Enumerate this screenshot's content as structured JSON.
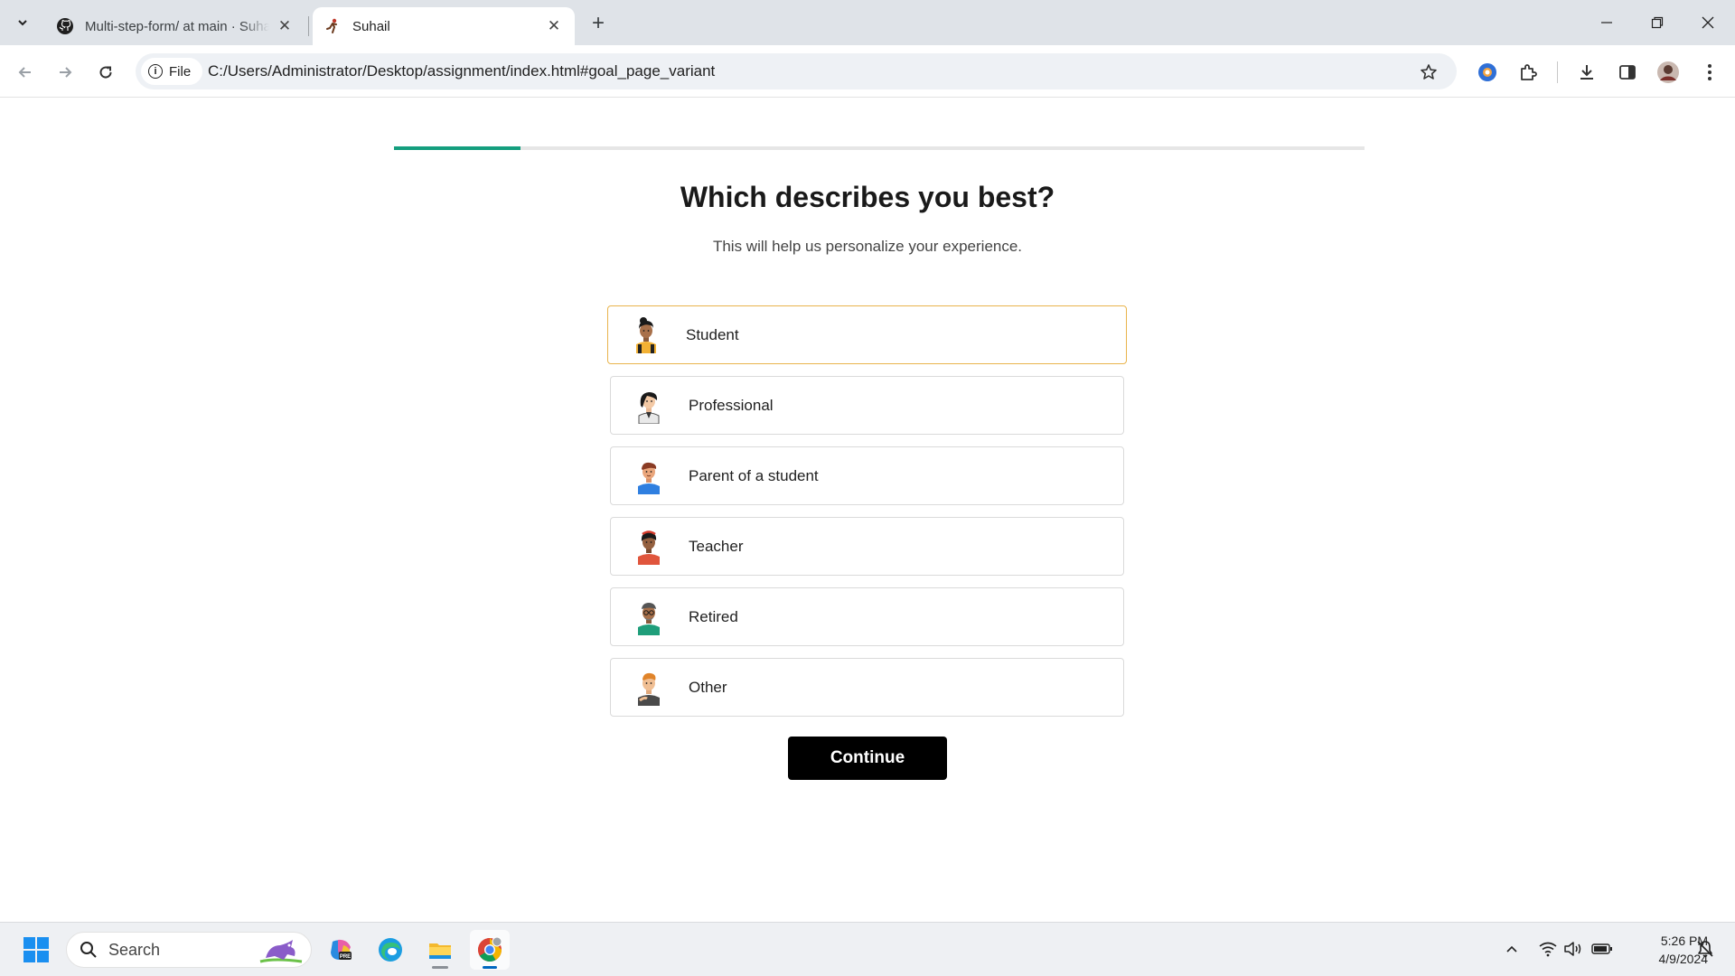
{
  "browser": {
    "tabs": [
      {
        "title": "Multi-step-form/ at main · Suhail",
        "icon": "github-icon",
        "active": false
      },
      {
        "title": "Suhail",
        "icon": "runner-favicon",
        "active": true
      }
    ],
    "address": {
      "chip_label": "File",
      "url": "C:/Users/Administrator/Desktop/assignment/index.html#goal_page_variant"
    }
  },
  "page": {
    "progress_fraction": 0.13,
    "progress_color": "#149e7e",
    "title": "Which describes you best?",
    "subtitle": "This will help us personalize your experience.",
    "options": [
      {
        "label": "Student",
        "icon": "student-avatar",
        "selected": true
      },
      {
        "label": "Professional",
        "icon": "professional-avatar",
        "selected": false
      },
      {
        "label": "Parent of a student",
        "icon": "parent-avatar",
        "selected": false
      },
      {
        "label": "Teacher",
        "icon": "teacher-avatar",
        "selected": false
      },
      {
        "label": "Retired",
        "icon": "retired-avatar",
        "selected": false
      },
      {
        "label": "Other",
        "icon": "other-avatar",
        "selected": false
      }
    ],
    "continue_label": "Continue",
    "selected_border_color": "#e9b44c"
  },
  "taskbar": {
    "search_placeholder": "Search",
    "time": "5:26 PM",
    "date": "4/9/2024"
  }
}
